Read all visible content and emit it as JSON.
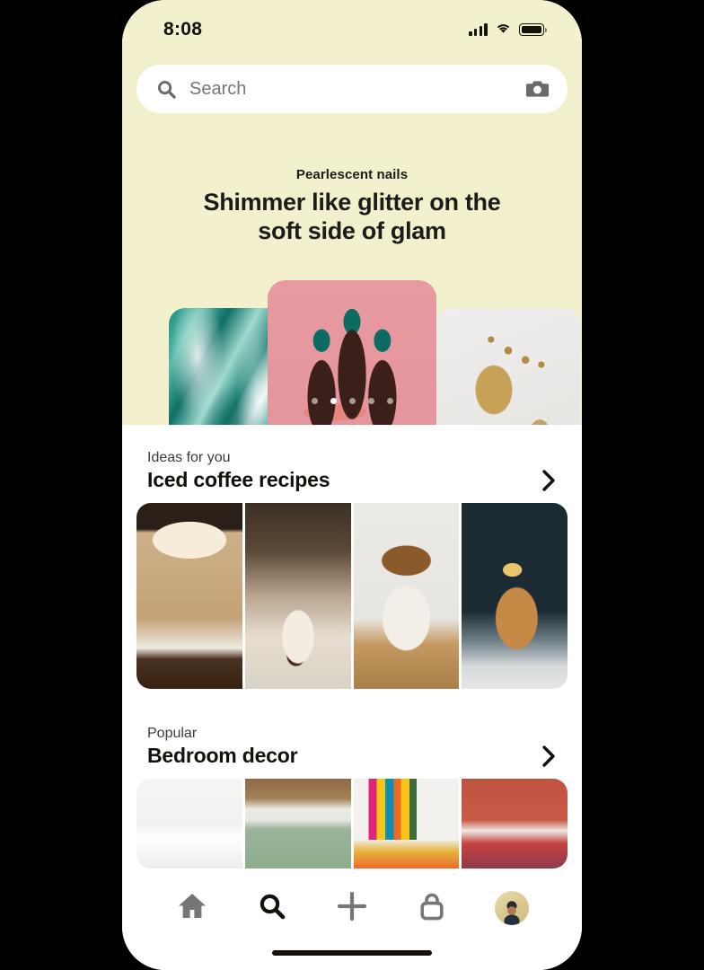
{
  "status_bar": {
    "time": "8:08",
    "signal_icon": "cellular-signal-icon",
    "wifi_icon": "wifi-icon",
    "battery_icon": "battery-full-icon"
  },
  "search": {
    "placeholder": "Search",
    "search_icon": "search-icon",
    "camera_icon": "camera-icon"
  },
  "hero": {
    "eyebrow": "Pearlescent nails",
    "title_line1": "Shimmer like glitter on the",
    "title_line2": "soft side of glam",
    "background_color": "#F2F0CD",
    "carousel": {
      "dots_total": 5,
      "active_index": 1,
      "cards": [
        {
          "alt": "teal marble nail art swirl",
          "accent": "#177d72"
        },
        {
          "alt": "dark hand with teal nails and gummy candy on pink",
          "accent": "#e2949a"
        },
        {
          "alt": "gold pearlescent nail polish swatch",
          "accent": "#c8a158"
        }
      ]
    }
  },
  "sections": [
    {
      "eyebrow": "Ideas for you",
      "title": "Iced coffee recipes",
      "chevron_icon": "chevron-right-icon",
      "tiles": [
        {
          "alt": "iced caramel latte with whipped cream on coffee beans",
          "style": "coffee1"
        },
        {
          "alt": "pouring milk and espresso into a glass",
          "style": "coffee2"
        },
        {
          "alt": "iced latte in tall glass on checkered coaster",
          "style": "coffee3"
        },
        {
          "alt": "hand holding iced tea with straw and pineapple",
          "style": "coffee4"
        }
      ]
    },
    {
      "eyebrow": "Popular",
      "title": "Bedroom decor",
      "chevron_icon": "chevron-right-icon",
      "tiles": [
        {
          "alt": "minimal white bedroom with white headboard",
          "style": "bed1"
        },
        {
          "alt": "sage green pillows with rattan headboard",
          "style": "bed2"
        },
        {
          "alt": "rainbow striped painted headboard bedroom",
          "style": "bed3"
        },
        {
          "alt": "terracotta wall bedroom with striped bedding",
          "style": "bed4"
        }
      ]
    }
  ],
  "bottom_nav": {
    "items": [
      {
        "name": "home",
        "icon": "home-icon",
        "active": false
      },
      {
        "name": "search",
        "icon": "search-icon",
        "active": true
      },
      {
        "name": "create",
        "icon": "plus-icon",
        "active": false
      },
      {
        "name": "shop",
        "icon": "shopping-bag-icon",
        "active": false
      },
      {
        "name": "profile",
        "icon": "avatar-icon",
        "active": false
      }
    ]
  },
  "home_indicator": "home-indicator-bar"
}
